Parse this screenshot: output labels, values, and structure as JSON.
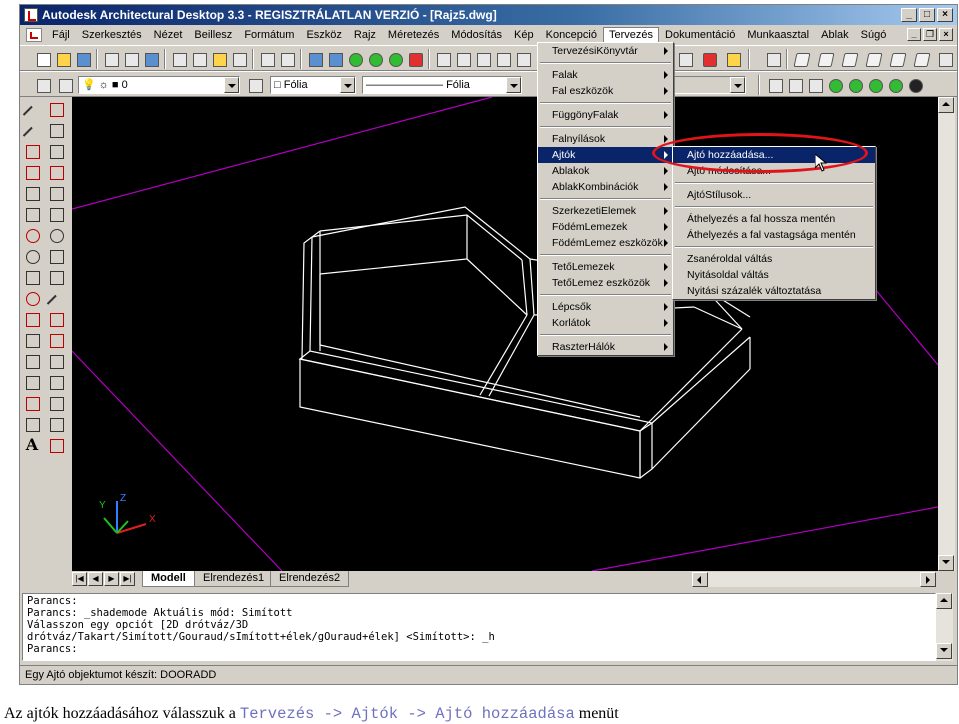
{
  "window": {
    "title": "Autodesk Architectural Desktop 3.3 - REGISZTRÁLATLAN VERZIÓ - [Rajz5.dwg]"
  },
  "menubar": {
    "items": [
      "Fájl",
      "Szerkesztés",
      "Nézet",
      "Beillesz",
      "Formátum",
      "Eszköz",
      "Rajz",
      "Méretezés",
      "Módosítás",
      "Kép",
      "Koncepció",
      "Tervezés",
      "Dokumentáció",
      "Munkaasztal",
      "Ablak",
      "Súgó"
    ],
    "active_item": "Tervezés"
  },
  "toolbar2": {
    "layer_value": "0",
    "linetype_value": "Fólia",
    "lineweight_value": "Fólia"
  },
  "tervezes_menu": {
    "groups": [
      [
        "TervezésiKönyvtár"
      ],
      [
        "Falak",
        "Fal eszközök"
      ],
      [
        "FüggönyFalak"
      ],
      [
        "Falnyílások",
        "Ajtók",
        "Ablakok",
        "AblakKombinációk"
      ],
      [
        "SzerkezetiElemek",
        "FödémLemezek",
        "FödémLemez eszközök"
      ],
      [
        "TetőLemezek",
        "TetőLemez eszközök"
      ],
      [
        "Lépcsők",
        "Korlátok"
      ],
      [
        "RaszterHálók"
      ]
    ],
    "selected": "Ajtók"
  },
  "ajtok_submenu": {
    "groups": [
      [
        "Ajtó hozzáadása...",
        "Ajtó módosítása..."
      ],
      [
        "AjtóStílusok..."
      ],
      [
        "Áthelyezés a fal hossza mentén",
        "Áthelyezés a fal vastagsága mentén"
      ],
      [
        "Zsanéroldal váltás",
        "Nyitásoldal váltás",
        "Nyitási százalék változtatása"
      ]
    ],
    "selected": "Ajtó hozzáadása..."
  },
  "layout_tabs": [
    "Modell",
    "Elrendezés1",
    "Elrendezés2"
  ],
  "active_tab": "Modell",
  "ucs_labels": {
    "x": "X",
    "y": "Y",
    "z": "Z"
  },
  "command_lines": [
    "Parancs:",
    "Parancs: _shademode Aktuális mód: Simított",
    "Válasszon egy opciót [2D drótváz/3D",
    "drótváz/Takart/Simított/Gouraud/sImított+élek/gOuraud+élek] <Simított>: _h",
    "Parancs:"
  ],
  "status_text": "Egy Ajtó objektumot készít: DOORADD",
  "caption": {
    "prefix": "Az ajtók hozzáadásához válasszuk a ",
    "path": "Tervezés -> Ajtók -> Ajtó hozzáadása",
    "suffix": " menüt"
  },
  "colors": {
    "title_gradient_start": "#0a246a",
    "menu_highlight": "#0a246a",
    "viewport_bg": "#000000",
    "magenta_lines": "#b000c0",
    "annotation_ellipse": "#e0141b"
  }
}
